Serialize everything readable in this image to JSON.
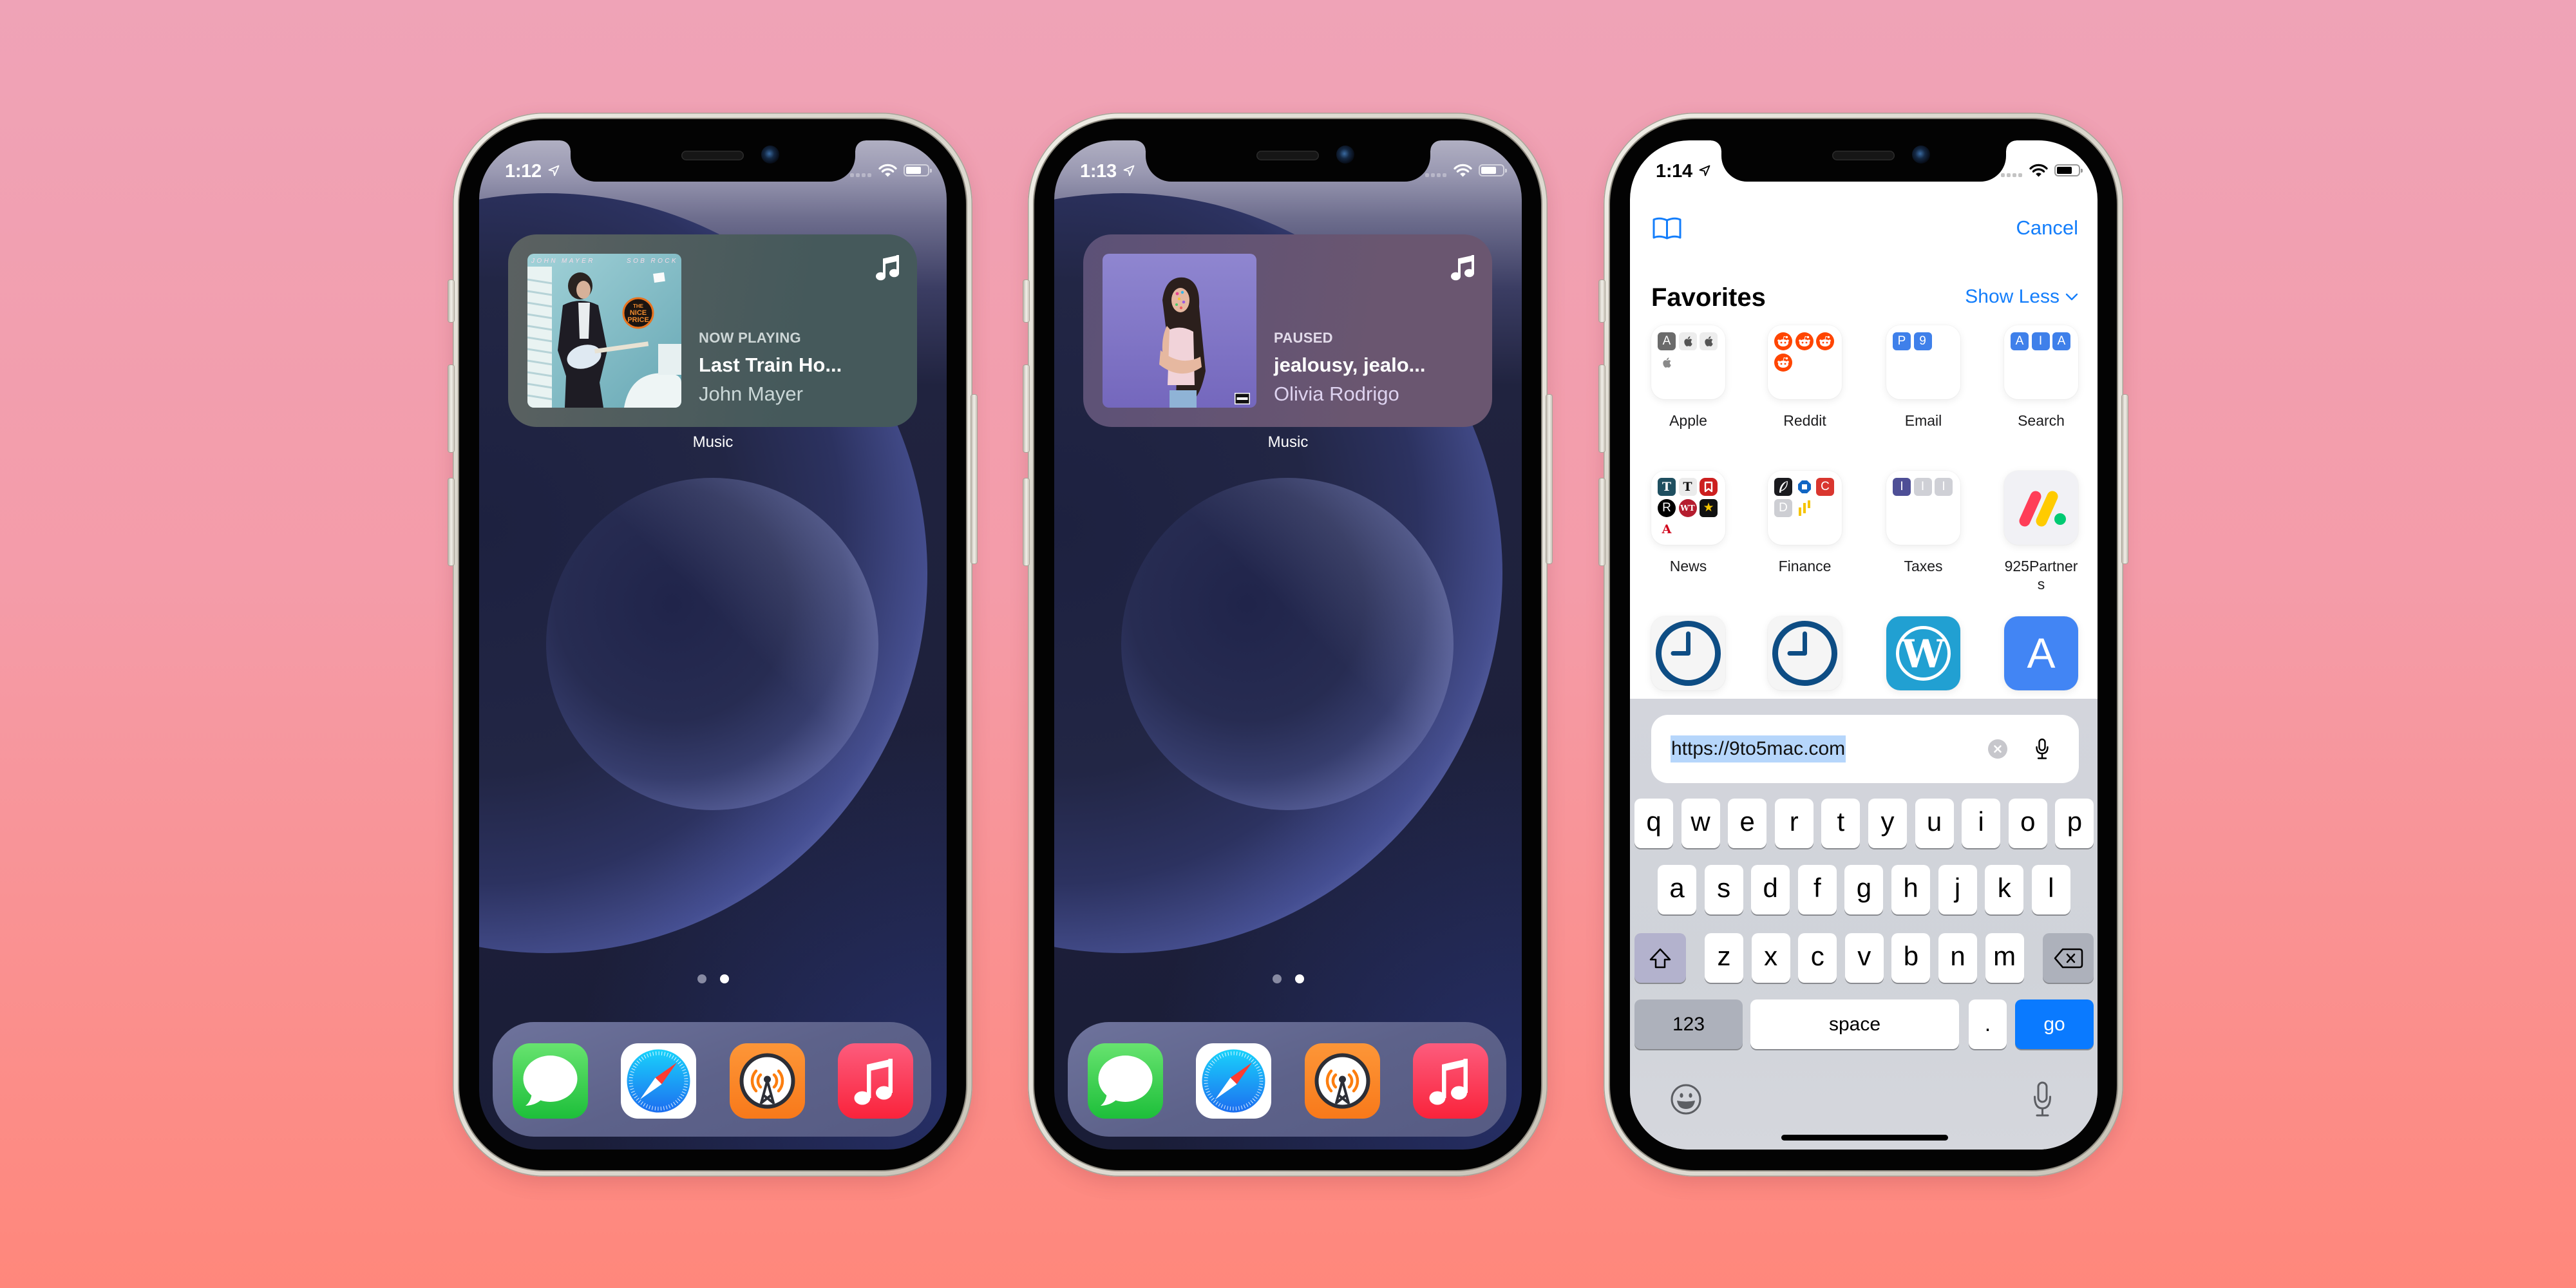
{
  "page": {
    "background_top": "#efa3b7",
    "background_bottom": "#ff877b"
  },
  "home_screens": [
    {
      "status": {
        "time": "1:12",
        "battery_level": 0.72
      },
      "widget": {
        "state": "NOW PLAYING",
        "title": "Last Train Ho...",
        "artist": "John Mayer",
        "app_icon": "music-note-icon",
        "colors": {
          "start": "#5b6161",
          "end": "#45595b"
        },
        "album_art": {
          "top_left_text": "JOHN MAYER",
          "top_right_text": "SOB ROCK",
          "sticker_lines": [
            "THE",
            "NICE",
            "PRICE"
          ]
        }
      },
      "widget_label": "Music",
      "page_dots": {
        "count": 2,
        "active": 1
      },
      "dock": [
        {
          "icon": "messages-icon"
        },
        {
          "icon": "safari-icon"
        },
        {
          "icon": "overcast-icon"
        },
        {
          "icon": "music-app-icon"
        }
      ]
    },
    {
      "status": {
        "time": "1:13",
        "battery_level": 0.72
      },
      "widget": {
        "state": "PAUSED",
        "title": "jealousy, jealo...",
        "artist": "Olivia Rodrigo",
        "app_icon": "music-note-icon",
        "colors": {
          "start": "#5c5177",
          "end": "#6a5670"
        },
        "album_art": {
          "badge": "explicit-content-icon"
        }
      },
      "widget_label": "Music",
      "page_dots": {
        "count": 2,
        "active": 1
      },
      "dock": [
        {
          "icon": "messages-icon"
        },
        {
          "icon": "safari-icon"
        },
        {
          "icon": "overcast-icon"
        },
        {
          "icon": "music-app-icon"
        }
      ]
    }
  ],
  "safari": {
    "status": {
      "time": "1:14",
      "battery_level": 0.72
    },
    "accent_color": "#147efb",
    "toolbar": {
      "bookmarks_icon": "book-icon",
      "cancel_label": "Cancel"
    },
    "favorites": {
      "title": "Favorites",
      "toggle_label": "Show Less",
      "items": [
        {
          "label": "Apple",
          "minis": [
            {
              "t": "A",
              "bg": "#6b6b6b"
            },
            {
              "icon": "apple",
              "bg": "#ededed",
              "fg": "#555555"
            },
            {
              "icon": "apple",
              "bg": "#ededed",
              "fg": "#555555"
            },
            {
              "icon": "apple",
              "bg": "#ffffff",
              "fg": "#8a8a8a"
            }
          ]
        },
        {
          "label": "Reddit",
          "minis": [
            {
              "icon": "reddit"
            },
            {
              "icon": "reddit"
            },
            {
              "icon": "reddit"
            },
            {
              "icon": "reddit"
            }
          ]
        },
        {
          "label": "Email",
          "minis": [
            {
              "t": "P",
              "bg": "#3f80ea"
            },
            {
              "t": "9",
              "bg": "#3f80ea"
            }
          ]
        },
        {
          "label": "Search",
          "minis": [
            {
              "t": "A",
              "bg": "#3f80ea"
            },
            {
              "t": "I",
              "bg": "#3f80ea"
            },
            {
              "t": "A",
              "bg": "#3f80ea"
            }
          ]
        },
        {
          "label": "News",
          "minis": [
            {
              "t": "T",
              "bg": "#1f4f60",
              "serif": true
            },
            {
              "t": "T",
              "bg": "#ebebeb",
              "fg": "#111111",
              "serif": true
            },
            {
              "icon": "bookmark"
            },
            {
              "t": "R",
              "bg": "#000000",
              "round": true
            },
            {
              "t": "WT",
              "bg": "#b51d2f",
              "round": true,
              "serif": true
            },
            {
              "t": "★",
              "bg": "#111111",
              "fg": "#f5c400"
            },
            {
              "t": "A",
              "bg": "#ffffff",
              "fg": "#d0021b",
              "serif": true
            }
          ]
        },
        {
          "label": "Finance",
          "minis": [
            {
              "icon": "feather"
            },
            {
              "icon": "chase"
            },
            {
              "t": "C",
              "bg": "#d9362f"
            },
            {
              "t": "D",
              "bg": "#cdced3"
            },
            {
              "icon": "bars"
            }
          ]
        },
        {
          "label": "Taxes",
          "minis": [
            {
              "t": "I",
              "bg": "#4e4f96"
            },
            {
              "t": "I",
              "bg": "#cfd0d6"
            },
            {
              "t": "I",
              "bg": "#cfd0d6"
            }
          ]
        },
        {
          "label": "925Partners",
          "icon": "monday-logo",
          "tile_bg": "#f1f1f5"
        },
        {
          "icon": "clock",
          "tile_bg": "#f5f5f5"
        },
        {
          "icon": "clock",
          "tile_bg": "#f5f5f5"
        },
        {
          "icon": "wordpress",
          "glyph": "W",
          "tile_bg": "#21a0d2"
        },
        {
          "t": "A",
          "tile_bg": "#4285f4"
        }
      ]
    },
    "url_bar": {
      "value": "https://9to5mac.com",
      "selected": true,
      "clear_icon": "clear-icon",
      "dictation_icon": "mic-icon"
    },
    "keyboard": {
      "rows": [
        [
          "q",
          "w",
          "e",
          "r",
          "t",
          "y",
          "u",
          "i",
          "o",
          "p"
        ],
        [
          "a",
          "s",
          "d",
          "f",
          "g",
          "h",
          "j",
          "k",
          "l"
        ],
        [
          "z",
          "x",
          "c",
          "v",
          "b",
          "n",
          "m"
        ]
      ],
      "shift_icon": "shift-icon",
      "delete_icon": "delete-icon",
      "numbers_label": "123",
      "space_label": "space",
      "period_label": ".",
      "go_label": "go",
      "go_color": "#0a7aff",
      "emoji_icon": "emoji-icon",
      "dictation_icon": "mic-icon"
    }
  }
}
